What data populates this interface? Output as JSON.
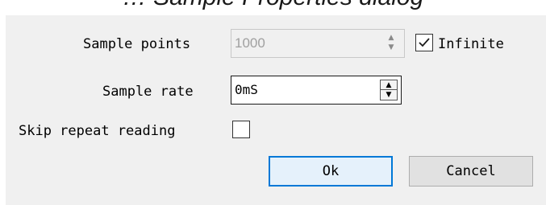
{
  "window": {
    "title_fragment": "… Sample Properties dialog"
  },
  "form": {
    "sample_points": {
      "label": "Sample points",
      "value": "1000",
      "enabled": false
    },
    "infinite": {
      "label": "Infinite",
      "checked": true
    },
    "sample_rate": {
      "label": "Sample rate",
      "value": "0mS"
    },
    "skip_repeat": {
      "label": "Skip repeat reading",
      "checked": false
    }
  },
  "buttons": {
    "ok": "Ok",
    "cancel": "Cancel"
  },
  "icons": {
    "spin_up": "spin-up-arrow",
    "spin_down": "spin-down-arrow",
    "checkmark": "check-icon"
  },
  "colors": {
    "dialog_bg": "#f0f0f0",
    "default_button_border": "#0078d7"
  }
}
